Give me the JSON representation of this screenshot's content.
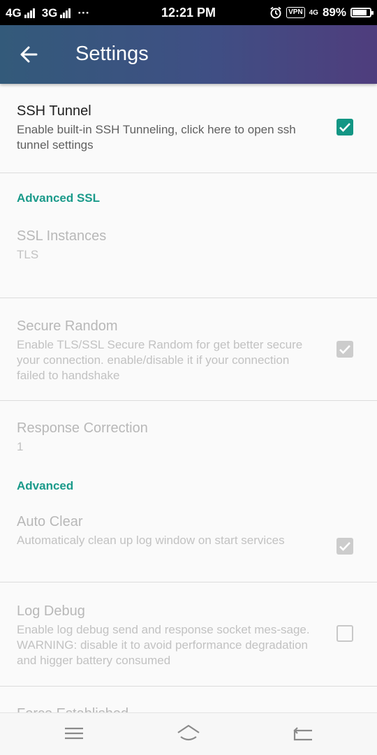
{
  "status_bar": {
    "network1": "4G",
    "network2": "3G",
    "more": "···",
    "time": "12:21 PM",
    "vpn_label": "VPN",
    "network3": "4G",
    "battery": "89%",
    "battery_level": 0.89
  },
  "toolbar": {
    "title": "Settings",
    "back_icon": "arrow-left-icon"
  },
  "preferences": {
    "ssh_tunnel": {
      "title": "SSH Tunnel",
      "summary": "Enable built-in SSH Tunneling, click here to open ssh tunnel settings",
      "checked": true
    },
    "cat_advanced_ssl": "Advanced SSL",
    "ssl_instances": {
      "title": "SSL Instances",
      "value": "TLS"
    },
    "secure_random": {
      "title": "Secure Random",
      "summary": "Enable TLS/SSL Secure Random for get better secure your connection. enable/disable it if your connection failed to handshake",
      "checked": true
    },
    "response_correction": {
      "title": "Response Correction",
      "value": "1"
    },
    "cat_advanced": "Advanced",
    "auto_clear": {
      "title": "Auto Clear",
      "summary": "Automaticaly clean up log window on start services",
      "checked": true
    },
    "log_debug": {
      "title": "Log Debug",
      "summary": "Enable log debug send and response socket mes-sage. WARNING: disable it to avoid performance degradation and higger battery consumed",
      "checked": false
    },
    "force_established": {
      "title": "Force Established"
    }
  },
  "nav_bar": {
    "icons": [
      "menu-icon",
      "home-icon",
      "back-icon"
    ]
  },
  "colors": {
    "accent": "#129684",
    "category": "#1a9a8a",
    "toolbar_start": "#335a7a",
    "toolbar_end": "#4f3d7d"
  }
}
